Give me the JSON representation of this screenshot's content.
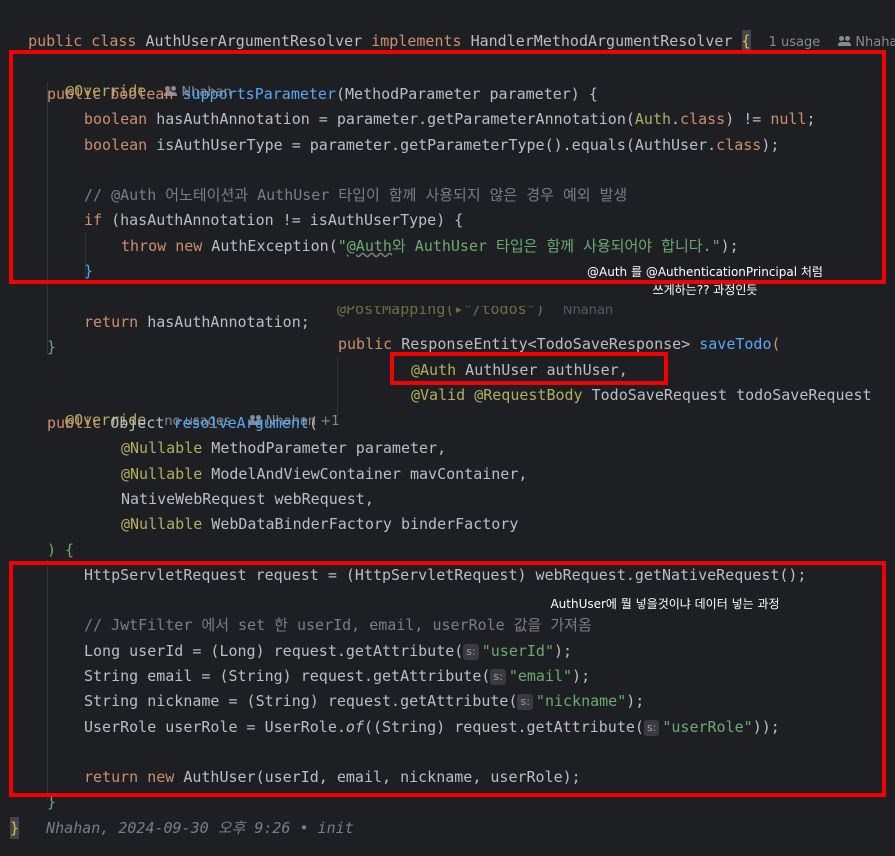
{
  "header": {
    "kw_public": "public",
    "kw_class": "class",
    "class_name": "AuthUserArgumentResolver",
    "kw_implements": "implements",
    "iface": "HandlerMethodArgumentResolver",
    "brace": "{",
    "usage": "1 usage",
    "author": "Nhahan"
  },
  "method1": {
    "override": "@Override",
    "author": "Nhahan",
    "sig_public": "public",
    "sig_boolean": "boolean",
    "sig_name": "supportsParameter",
    "sig_params": "(MethodParameter parameter) {",
    "l1_kw": "boolean",
    "l1_rest": " hasAuthAnnotation = parameter.getParameterAnnotation(",
    "l1_ann": "Auth",
    "l1_dot": ".",
    "l1_class": "class",
    "l1_end": ") != ",
    "l1_null": "null",
    "l1_semi": ";",
    "l2_kw": "boolean",
    "l2_rest": " isAuthUserType = parameter.getParameterType().equals(AuthUser.",
    "l2_class": "class",
    "l2_end": ");",
    "comment": "// @Auth 어노테이션과 AuthUser 타입이 함께 사용되지 않은 경우 예외 발생",
    "if_kw": "if",
    "if_rest": " (hasAuthAnnotation != isAuthUserType) {",
    "throw_kw": "throw",
    "new_kw": "new",
    "throw_rest": " AuthException(",
    "throw_str_a": "\"",
    "throw_str_b": "@Auth",
    "throw_str_c": "와 AuthUser 타입은 함께 사용되어야 합니다.\"",
    "throw_end": ");",
    "close_if": "}",
    "return_kw": "return",
    "return_rest": " hasAuthAnnotation;",
    "close": "}"
  },
  "pasted": {
    "mapping": "@PostMapping(▸\"/todos\")",
    "mapping_author": "Nhahan",
    "public_kw": "public",
    "sig_rest": " ResponseEntity<TodoSaveResponse> ",
    "sig_fn": "saveTodo",
    "sig_open": "(",
    "p1_ann": "@Auth",
    "p1_rest": " AuthUser authUser,",
    "p2_ann": "@Valid @RequestBody",
    "p2_rest": " TodoSaveRequest todoSaveRequest"
  },
  "method2": {
    "override": "@Override",
    "usage": "no usages",
    "author": "Nhahan +1",
    "sig_public": "public",
    "sig_rest": " Object ",
    "sig_name": "resolveArgument",
    "sig_open": "(",
    "p1_ann": "@Nullable",
    "p1_rest": " MethodParameter parameter,",
    "p2_ann": "@Nullable",
    "p2_rest": " ModelAndViewContainer mavContainer,",
    "p3_rest": "NativeWebRequest webRequest,",
    "p4_ann": "@Nullable",
    "p4_rest": " WebDataBinderFactory binderFactory",
    "p_close": ") {",
    "l1": "HttpServletRequest request = (HttpServletRequest) webRequest.getNativeRequest();",
    "comment": "// JwtFilter 에서 set 한 userId, email, userRole 값을 가져옴",
    "l2_a": "Long userId = (Long) request.getAttribute(",
    "l2_s": "\"userId\"",
    "l2_e": ");",
    "l3_a": "String email = (String) request.getAttribute(",
    "l3_s": "\"email\"",
    "l3_e": ");",
    "l4_a": "String nickname = (String) request.getAttribute(",
    "l4_s": "\"nickname\"",
    "l4_e": ");",
    "l5_a": "UserRole userRole = UserRole.",
    "l5_of": "of",
    "l5_b": "((String) request.getAttribute(",
    "l5_s": "\"userRole\"",
    "l5_e": "));",
    "hint": "s:",
    "ret_kw": "return",
    "ret_new": "new",
    "ret_rest": " AuthUser(userId, email, nickname, userRole);",
    "close": "}"
  },
  "footer": {
    "brace": "}",
    "blame": "Nhahan, 2024-09-30 오후 9:26 • init"
  },
  "notes": {
    "note1": "@Auth 를 @AuthenticationPrincipal 처럼\n쓰게하는?? 과정인듯",
    "note2": "AuthUser에 뭘 넣을것이냐 데이터 넣는 과정"
  },
  "colors": {
    "background": "#1e1f22",
    "highlight": "#f20000",
    "keyword": "#cf8e6d",
    "annotation": "#b3ae60",
    "function": "#56a8f5",
    "string": "#6aab73"
  }
}
